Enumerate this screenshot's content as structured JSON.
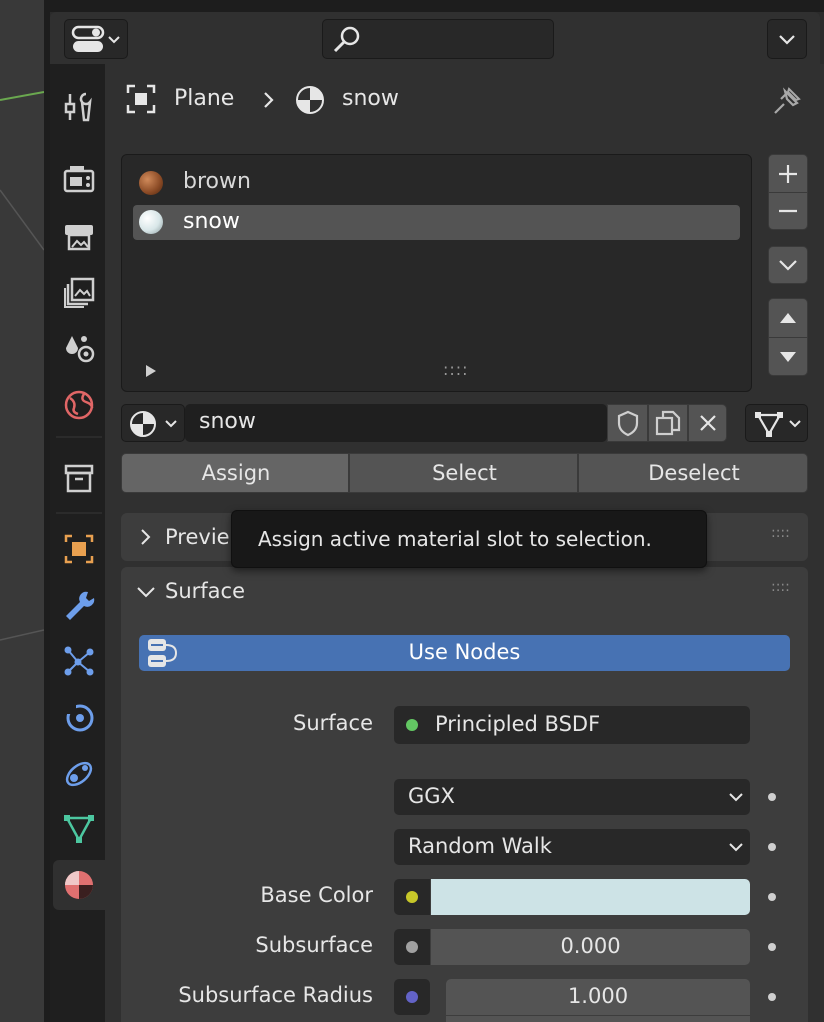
{
  "header": {
    "search": {
      "value": "",
      "placeholder": ""
    }
  },
  "breadcrumb": {
    "object": "Plane",
    "material": "snow"
  },
  "material_slots": [
    {
      "name": "brown",
      "color": "#8a4a25",
      "active": false
    },
    {
      "name": "snow",
      "color": "#d8e6e8",
      "active": true
    }
  ],
  "slot_list": {
    "grip": "::::"
  },
  "material_name": {
    "value": "snow"
  },
  "buttons": {
    "assign": "Assign",
    "select": "Select",
    "deselect": "Deselect"
  },
  "panels": {
    "preview": {
      "label": "Previe"
    },
    "surface": {
      "label": "Surface"
    }
  },
  "tooltip": {
    "text": "Assign active material slot to selection."
  },
  "use_nodes": {
    "label": "Use Nodes",
    "color": "#4772b3"
  },
  "properties": {
    "surface": {
      "label": "Surface",
      "value": "Principled BSDF",
      "socket_color": "#63c763"
    },
    "distribution": {
      "value": "GGX"
    },
    "subsurface_method": {
      "value": "Random Walk"
    },
    "base_color": {
      "label": "Base Color",
      "socket_color": "#c7c729",
      "swatch": "#cde3e6"
    },
    "subsurface": {
      "label": "Subsurface",
      "value": "0.000",
      "socket_color": "#a1a1a1"
    },
    "subsurface_radius": {
      "label": "Subsurface Radius",
      "value": "1.000",
      "socket_color": "#6363c7"
    }
  },
  "tab_icons": [
    "tool-icon",
    "render-icon",
    "output-icon",
    "view-layer-icon",
    "scene-icon",
    "world-icon",
    "collection-icon",
    "object-icon",
    "modifier-icon",
    "particles-icon",
    "physics-icon",
    "constraints-icon",
    "data-icon",
    "material-icon"
  ]
}
